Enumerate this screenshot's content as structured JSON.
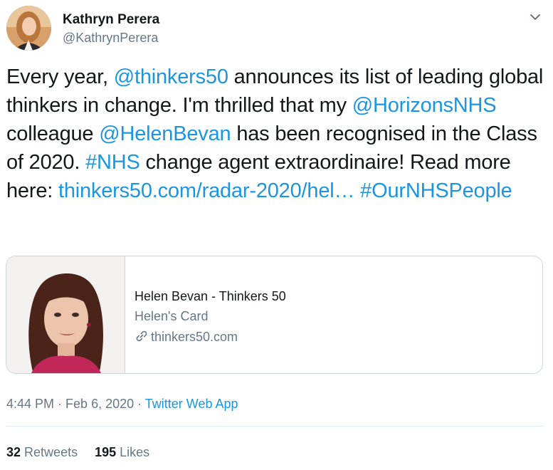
{
  "author": {
    "name": "Kathryn Perera",
    "handle": "@KathrynPerera"
  },
  "tweet": {
    "segments": [
      {
        "text": "Every year, ",
        "type": "text"
      },
      {
        "text": "@thinkers50",
        "type": "link"
      },
      {
        "text": " announces its list of leading global thinkers in change. I'm thrilled that my ",
        "type": "text"
      },
      {
        "text": "@HorizonsNHS",
        "type": "link"
      },
      {
        "text": " colleague ",
        "type": "text"
      },
      {
        "text": "@HelenBevan",
        "type": "link"
      },
      {
        "text": " has been recognised in the Class of 2020. ",
        "type": "text"
      },
      {
        "text": "#NHS",
        "type": "link"
      },
      {
        "text": " change agent extraordinaire! Read more here: ",
        "type": "text"
      },
      {
        "text": "thinkers50.com/radar-2020/hel…",
        "type": "link"
      },
      {
        "text": " ",
        "type": "text"
      },
      {
        "text": "#OurNHSPeople",
        "type": "link"
      }
    ]
  },
  "card": {
    "title": "Helen Bevan - Thinkers 50",
    "description": "Helen's Card",
    "domain": "thinkers50.com",
    "link_icon": "link-icon"
  },
  "meta": {
    "time": "4:44 PM",
    "separator": " · ",
    "date": "Feb 6, 2020",
    "app": "Twitter Web App"
  },
  "stats": {
    "retweets_count": "32",
    "retweets_label": "Retweets",
    "likes_count": "195",
    "likes_label": "Likes"
  },
  "colors": {
    "link": "#1b95e0",
    "secondary_text": "#657786",
    "primary_text": "#14171a",
    "border": "#ccd6dd"
  },
  "icons": {
    "caret": "chevron-down-icon",
    "link": "link-icon"
  }
}
